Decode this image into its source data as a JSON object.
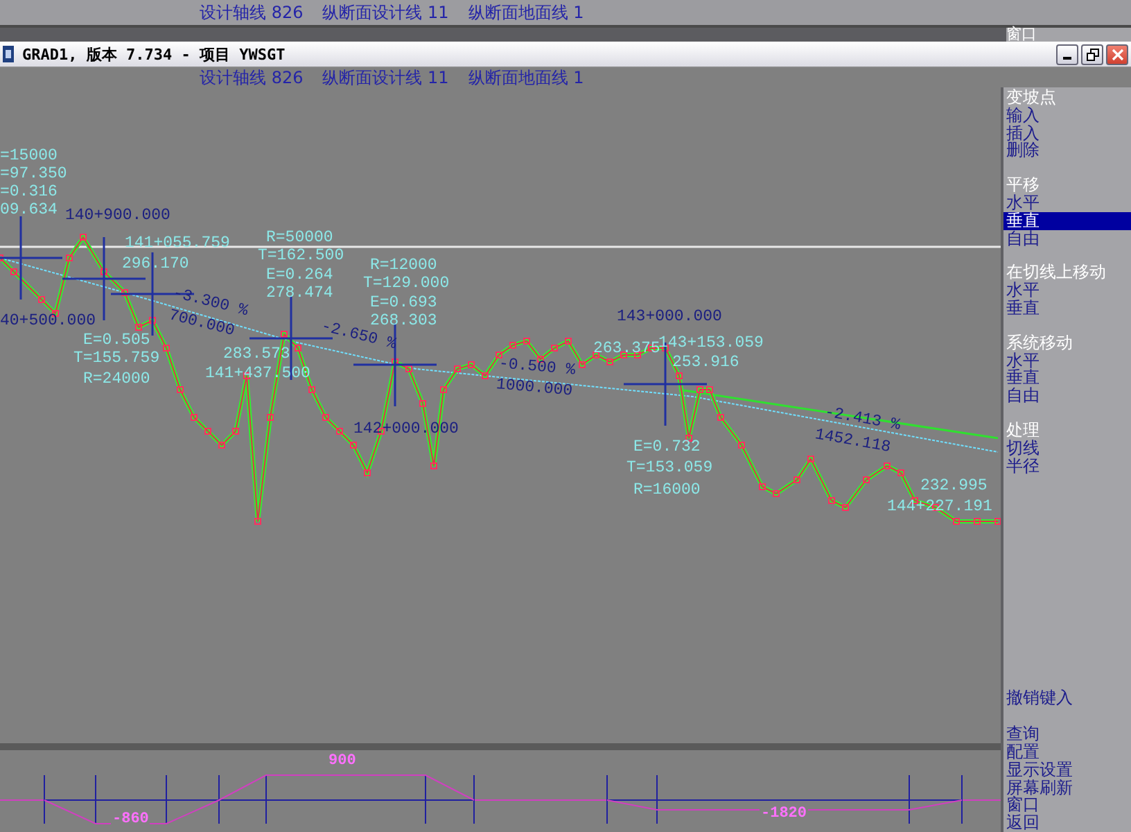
{
  "background_window": {
    "status": [
      "设计轴线 826",
      "纵断面设计线 11",
      "纵断面地面线 1"
    ],
    "menu_item": "窗口"
  },
  "window": {
    "title": "GRAD1, 版本  7.734 - 项目 YWSGT"
  },
  "status_bar": {
    "segments": [
      "设计轴线 826",
      "纵断面设计线 11",
      "纵断面地面线 1"
    ]
  },
  "profile": {
    "labels": [
      {
        "text": "=15000",
        "kind": "curve"
      },
      {
        "text": "=97.350",
        "kind": "curve"
      },
      {
        "text": "=0.316",
        "kind": "curve"
      },
      {
        "text": "09.634",
        "kind": "curve"
      },
      {
        "text": "140+900.000",
        "kind": "station"
      },
      {
        "text": "141+055.759",
        "kind": "curve"
      },
      {
        "text": "296.170",
        "kind": "curve"
      },
      {
        "text": "-3.300 %",
        "kind": "grade"
      },
      {
        "text": "700.000",
        "kind": "grade"
      },
      {
        "text": "R=50000",
        "kind": "curve"
      },
      {
        "text": "T=162.500",
        "kind": "curve"
      },
      {
        "text": "E=0.264",
        "kind": "curve"
      },
      {
        "text": "278.474",
        "kind": "curve"
      },
      {
        "text": "R=12000",
        "kind": "curve"
      },
      {
        "text": "T=129.000",
        "kind": "curve"
      },
      {
        "text": "E=0.693",
        "kind": "curve"
      },
      {
        "text": "268.303",
        "kind": "curve"
      },
      {
        "text": "-2.650 %",
        "kind": "grade"
      },
      {
        "text": "283.573",
        "kind": "curve"
      },
      {
        "text": "141+437.500",
        "kind": "curve"
      },
      {
        "text": "E=0.505",
        "kind": "curve"
      },
      {
        "text": "T=155.759",
        "kind": "curve"
      },
      {
        "text": "R=24000",
        "kind": "curve"
      },
      {
        "text": "40+500.000",
        "kind": "station"
      },
      {
        "text": "142+000.000",
        "kind": "station"
      },
      {
        "text": "-0.500 %",
        "kind": "grade"
      },
      {
        "text": "1000.000",
        "kind": "grade"
      },
      {
        "text": "143+000.000",
        "kind": "station"
      },
      {
        "text": "263.375",
        "kind": "curve"
      },
      {
        "text": "143+153.059",
        "kind": "curve"
      },
      {
        "text": "253.916",
        "kind": "curve"
      },
      {
        "text": "E=0.732",
        "kind": "curve"
      },
      {
        "text": "T=153.059",
        "kind": "curve"
      },
      {
        "text": "R=16000",
        "kind": "curve"
      },
      {
        "text": "-2.413 %",
        "kind": "grade"
      },
      {
        "text": "1452.118",
        "kind": "grade"
      },
      {
        "text": "232.995",
        "kind": "curve"
      },
      {
        "text": "144+227.191",
        "kind": "curve"
      }
    ]
  },
  "slope_diagram": {
    "labels": [
      "-860",
      "900",
      "-1820"
    ]
  },
  "menu": {
    "groups": [
      {
        "title": "变坡点",
        "items": [
          {
            "label": "输入",
            "selected": false
          },
          {
            "label": "插入",
            "selected": false
          },
          {
            "label": "删除",
            "selected": false
          }
        ]
      },
      {
        "title": "平移",
        "items": [
          {
            "label": "水平",
            "selected": false
          },
          {
            "label": "垂直",
            "selected": true
          },
          {
            "label": "自由",
            "selected": false
          }
        ]
      },
      {
        "title": "在切线上移动",
        "items": [
          {
            "label": "水平",
            "selected": false
          },
          {
            "label": "垂直",
            "selected": false
          }
        ]
      },
      {
        "title": "系统移动",
        "items": [
          {
            "label": "水平",
            "selected": false
          },
          {
            "label": "垂直",
            "selected": false
          },
          {
            "label": "自由",
            "selected": false
          }
        ]
      },
      {
        "title": "处理",
        "items": [
          {
            "label": "切线",
            "selected": false
          },
          {
            "label": "半径",
            "selected": false
          }
        ]
      }
    ],
    "footer": [
      {
        "label": "撤销键入",
        "selected": false
      },
      {
        "label": "查询",
        "selected": false
      },
      {
        "label": "配置",
        "selected": false
      },
      {
        "label": "显示设置",
        "selected": false
      },
      {
        "label": "屏幕刷新",
        "selected": false
      },
      {
        "label": "窗口",
        "selected": false
      },
      {
        "label": "返回",
        "selected": false
      }
    ]
  }
}
